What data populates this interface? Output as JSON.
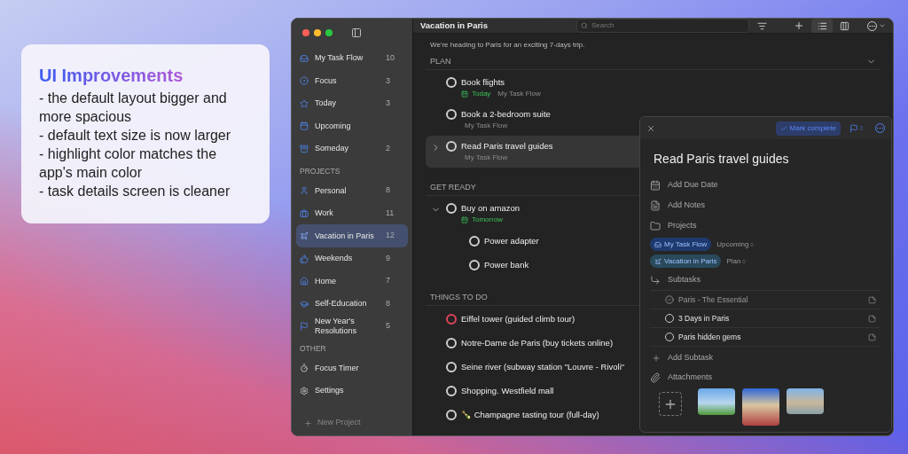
{
  "promo": {
    "title": "UI Improvements",
    "lines": [
      "- the default layout bigger and more spacious",
      "- default text size is now larger",
      "- highlight color matches the app's main color",
      "- task details screen is cleaner"
    ]
  },
  "sidebar": {
    "sections": [
      {
        "items": [
          {
            "label": "My Task Flow",
            "count": "10",
            "selected": false
          },
          {
            "label": "Focus",
            "count": "3",
            "selected": false
          },
          {
            "label": "Today",
            "count": "3",
            "selected": false
          },
          {
            "label": "Upcoming",
            "selected": false
          },
          {
            "label": "Someday",
            "count": "2",
            "selected": false
          }
        ]
      },
      {
        "title": "PROJECTS",
        "items": [
          {
            "label": "Personal",
            "count": "8",
            "selected": false
          },
          {
            "label": "Work",
            "count": "11",
            "selected": false
          },
          {
            "label": "Vacation in Paris",
            "count": "12",
            "selected": true
          },
          {
            "label": "Weekends",
            "count": "9",
            "selected": false
          },
          {
            "label": "Home",
            "count": "7",
            "selected": false
          },
          {
            "label": "Self-Education",
            "count": "8",
            "selected": false
          },
          {
            "label": "New Year's Resolutions",
            "count": "5",
            "selected": false
          }
        ]
      },
      {
        "title": "OTHER",
        "items": [
          {
            "label": "Focus Timer",
            "selected": false
          },
          {
            "label": "Settings",
            "selected": false
          }
        ]
      }
    ],
    "new_project": "New Project"
  },
  "toolbar": {
    "title": "Vacation in Paris",
    "search": {
      "placeholder": "Search"
    }
  },
  "project": {
    "description": "We're heading to Paris for an exciting 7-days trip.",
    "groups": [
      {
        "title": "PLAN",
        "collapsible": true,
        "tasks": [
          {
            "title": "Book flights",
            "date": "Today",
            "project": "My Task Flow",
            "selected": false,
            "color": "#cfcfcf"
          },
          {
            "title": "Book a 2-bedroom suite",
            "project": "My Task Flow",
            "selected": false,
            "color": "#cfcfcf"
          },
          {
            "title": "Read Paris travel guides",
            "project": "My Task Flow",
            "expanded": false,
            "selected": true,
            "color": "#cfcfcf"
          }
        ]
      },
      {
        "title": "GET READY",
        "tasks": [
          {
            "title": "Buy on amazon",
            "date": "Tomorrow",
            "expanded": true,
            "selected": false,
            "color": "#cfcfcf",
            "children": [
              {
                "title": "Power adapter",
                "selected": false,
                "color": "#cfcfcf"
              },
              {
                "title": "Power bank",
                "selected": false,
                "color": "#cfcfcf"
              }
            ]
          }
        ]
      },
      {
        "title": "THINGS TO DO",
        "tasks": [
          {
            "title": "Eiffel tower (guided climb tour)",
            "selected": false,
            "color": "#e0445c"
          },
          {
            "title": "Notre-Dame de Paris (buy tickets online)",
            "selected": false,
            "color": "#cfcfcf"
          },
          {
            "title": "Seine river (subway station \"Louvre - Rivoli\"",
            "selected": false,
            "color": "#cfcfcf"
          },
          {
            "title": "Shopping. Westfield mall",
            "selected": false,
            "color": "#cfcfcf"
          },
          {
            "title": "🍾 Champagne tasting tour (full-day)",
            "selected": false,
            "color": "#cfcfcf"
          }
        ]
      }
    ]
  },
  "details": {
    "mark_complete": "Mark complete",
    "title": "Read Paris travel guides",
    "due_date": "Add Due Date",
    "notes": "Add Notes",
    "projects_label": "Projects",
    "projects": [
      {
        "label": "My Task Flow",
        "section": "Upcoming",
        "color": "#1e3a6e"
      },
      {
        "label": "Vacation in Paris",
        "section": "Plan",
        "color": "#2a4a5c"
      }
    ],
    "subtasks_label": "Subtasks",
    "subtasks": [
      {
        "title": "Paris - The Essential",
        "done": true
      },
      {
        "title": "3 Days in Paris",
        "done": false
      },
      {
        "title": "Paris hidden gems",
        "done": false
      }
    ],
    "add_subtask": "Add Subtask",
    "attachments_label": "Attachments"
  }
}
